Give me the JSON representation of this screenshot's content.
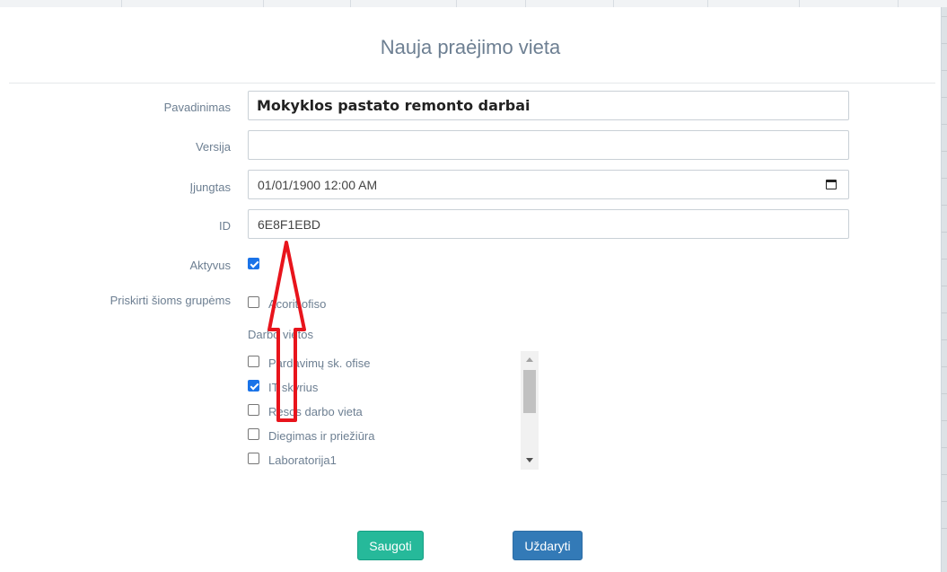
{
  "modal": {
    "title": "Nauja praėjimo vieta",
    "fields": {
      "name": {
        "label": "Pavadinimas",
        "value": "Mokyklos pastato remonto darbai"
      },
      "version": {
        "label": "Versija",
        "value": ""
      },
      "enabled": {
        "label": "Įjungtas",
        "value": "01/01/1900 12:00 AM"
      },
      "id": {
        "label": "ID",
        "value": "6E8F1EBD"
      },
      "active": {
        "label": "Aktyvus",
        "checked": true
      }
    },
    "groups": {
      "label": "Priskirti šioms grupėms",
      "office": {
        "label": "Acorit ofiso",
        "checked": false
      },
      "workplaces_label": "Darbo vietos",
      "workplaces": [
        {
          "label": "Pardavimų sk. ofise",
          "checked": false
        },
        {
          "label": "IT skyrius",
          "checked": true
        },
        {
          "label": "Resos darbo vieta",
          "checked": false
        },
        {
          "label": "Diegimas ir priežiūra",
          "checked": false
        },
        {
          "label": "Laboratorija1",
          "checked": false
        }
      ]
    },
    "buttons": {
      "save": "Saugoti",
      "close": "Uždaryti"
    }
  },
  "colors": {
    "label_text": "#6d7f92",
    "checkbox_checked": "#1a73e8",
    "save_button": "#26b99a",
    "close_button": "#337ab7",
    "annotation_arrow": "#e8141c"
  },
  "icons": {
    "date_picker": "calendar-icon",
    "annotation": "red-arrow-up"
  }
}
